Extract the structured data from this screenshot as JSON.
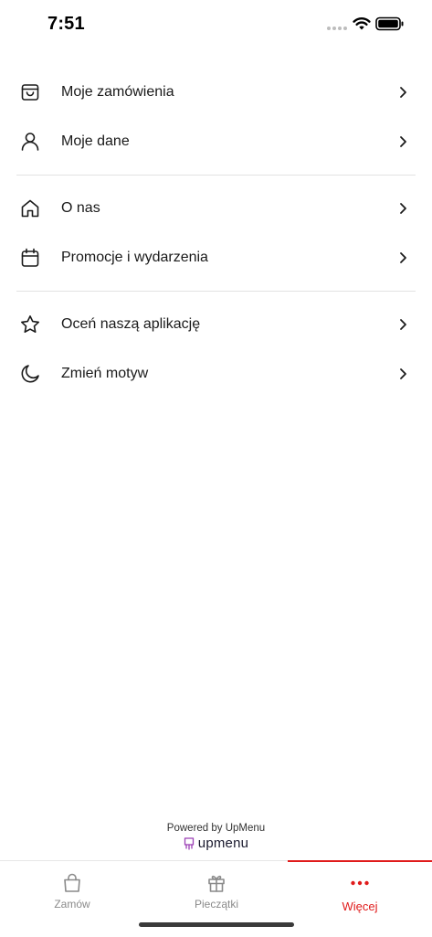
{
  "status_bar": {
    "time": "7:51"
  },
  "menu": {
    "group1": [
      {
        "label": "Moje zamówienia",
        "icon": "shopping-bag-icon"
      },
      {
        "label": "Moje dane",
        "icon": "user-icon"
      }
    ],
    "group2": [
      {
        "label": "O nas",
        "icon": "home-icon"
      },
      {
        "label": "Promocje i wydarzenia",
        "icon": "calendar-icon"
      }
    ],
    "group3": [
      {
        "label": "Oceń naszą aplikację",
        "icon": "star-icon"
      },
      {
        "label": "Zmień motyw",
        "icon": "moon-icon"
      }
    ]
  },
  "footer": {
    "powered_by": "Powered by UpMenu",
    "brand": "upmenu"
  },
  "tabbar": {
    "tabs": [
      {
        "label": "Zamów",
        "icon": "bag-icon"
      },
      {
        "label": "Pieczątki",
        "icon": "gift-icon"
      },
      {
        "label": "Więcej",
        "icon": "more-dots-icon"
      }
    ],
    "active_index": 2,
    "accent_color": "#e01b1b"
  }
}
